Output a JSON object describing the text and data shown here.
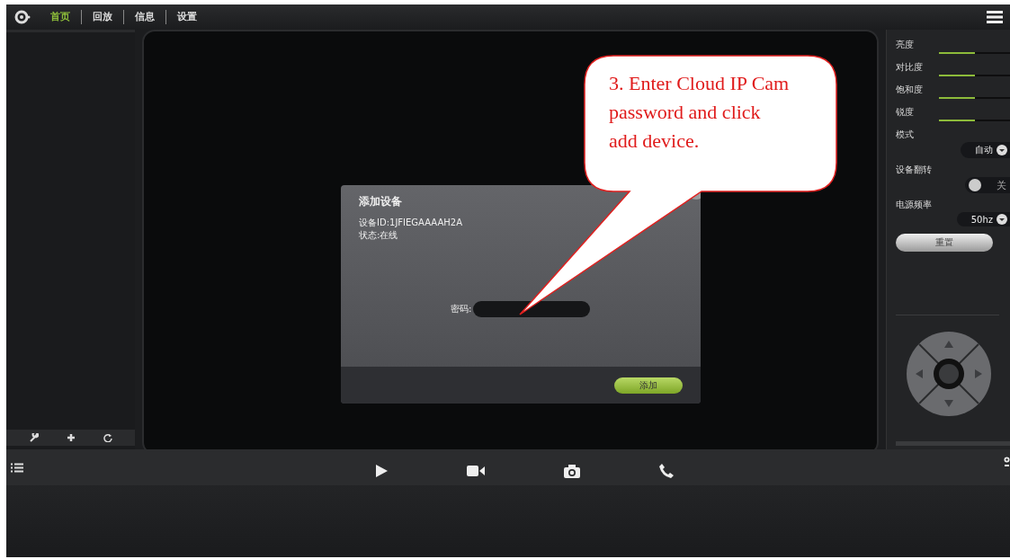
{
  "nav": [
    {
      "label": "首页",
      "selected": true
    },
    {
      "label": "回放",
      "selected": false
    },
    {
      "label": "信息",
      "selected": false
    },
    {
      "label": "设置",
      "selected": false
    }
  ],
  "image_settings": [
    {
      "label": "亮度",
      "level": 0.5
    },
    {
      "label": "对比度",
      "level": 0.5
    },
    {
      "label": "饱和度",
      "level": 0.5
    },
    {
      "label": "锐度",
      "level": 0.5
    }
  ],
  "mode": {
    "label": "模式",
    "value": "自动"
  },
  "flip": {
    "label": "设备翻转",
    "on": false,
    "state_text": "关"
  },
  "frequency": {
    "label": "电源频率",
    "value": "50hz"
  },
  "reset_button": "重置",
  "dialog": {
    "title": "添加设备",
    "device_id": "设备ID:1JFIEGAAAAH2A",
    "status": "状态:在线",
    "password_label": "密码:",
    "add_button": "添加"
  },
  "callout": {
    "text": "3. Enter Cloud IP Cam password and click add device."
  }
}
